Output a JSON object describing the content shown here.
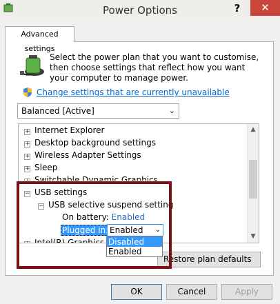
{
  "window": {
    "title": "Power Options",
    "help_label": "?",
    "close_label": "✕"
  },
  "tab": {
    "label": "Advanced settings"
  },
  "intro": {
    "text": "Select the power plan that you want to customise, then choose settings that reflect how you want your computer to manage power."
  },
  "change_link": {
    "label": "Change settings that are currently unavailable"
  },
  "plan_select": {
    "value": "Balanced [Active]"
  },
  "tree": {
    "items": [
      {
        "label": "Internet Explorer",
        "expander": "+"
      },
      {
        "label": "Desktop background settings",
        "expander": "+"
      },
      {
        "label": "Wireless Adapter Settings",
        "expander": "+"
      },
      {
        "label": "Sleep",
        "expander": "+"
      },
      {
        "label": "Switchable Dynamic Graphics",
        "expander": "+"
      },
      {
        "label": "USB settings",
        "expander": "−"
      },
      {
        "label": "USB selective suspend setting",
        "expander": "−"
      },
      {
        "label": "Intel(R) Graphics Se",
        "expander": "+"
      }
    ],
    "on_battery": {
      "label": "On battery:",
      "value": "Enabled"
    },
    "plugged_in": {
      "label": "Plugged in:",
      "value": "Enabled"
    }
  },
  "dropdown": {
    "options": [
      "Disabled",
      "Enabled"
    ],
    "selected": "Disabled"
  },
  "buttons": {
    "restore": "Restore plan defaults",
    "ok": "OK",
    "cancel": "Cancel",
    "apply": "Apply"
  },
  "icons": {
    "app": "power-options-icon",
    "battery": "battery-plug-icon",
    "shield": "uac-shield-icon"
  },
  "colors": {
    "link": "#0066cc",
    "highlight_box": "#7b1116",
    "selection": "#3399ff",
    "close": "#c9473a"
  }
}
